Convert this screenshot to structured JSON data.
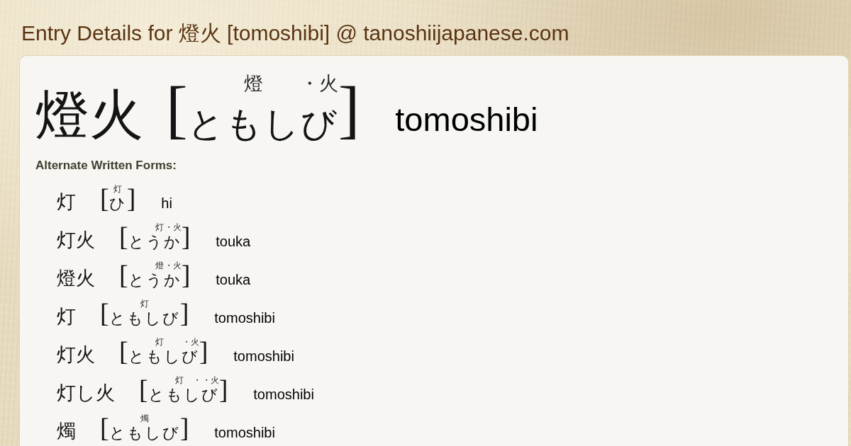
{
  "page": {
    "title": "Entry Details for 燈火 [tomoshibi] @ tanoshiijapanese.com"
  },
  "entry": {
    "word": "燈火",
    "reading": {
      "open": "[",
      "segments": [
        {
          "kana": "とも",
          "annotation": "燈"
        },
        {
          "kana": "しび",
          "annotation": "・火"
        }
      ],
      "close": "]"
    },
    "romaji": "tomoshibi"
  },
  "alternate_forms": {
    "heading": "Alternate Written Forms:",
    "items": [
      {
        "word": "灯",
        "reading": {
          "open": "[",
          "segments": [
            {
              "kana": "ひ",
              "annotation": "灯"
            }
          ],
          "close": "]"
        },
        "romaji": "hi"
      },
      {
        "word": "灯火",
        "reading": {
          "open": "[",
          "segments": [
            {
              "kana": "とう",
              "annotation": "灯"
            },
            {
              "kana": "か",
              "annotation": "・火"
            }
          ],
          "close": "]"
        },
        "romaji": "touka"
      },
      {
        "word": "燈火",
        "reading": {
          "open": "[",
          "segments": [
            {
              "kana": "とう",
              "annotation": "燈"
            },
            {
              "kana": "か",
              "annotation": "・火"
            }
          ],
          "close": "]"
        },
        "romaji": "touka"
      },
      {
        "word": "灯",
        "reading": {
          "open": "[",
          "segments": [
            {
              "kana": "ともしび",
              "annotation": "灯"
            }
          ],
          "close": "]"
        },
        "romaji": "tomoshibi"
      },
      {
        "word": "灯火",
        "reading": {
          "open": "[",
          "segments": [
            {
              "kana": "とも",
              "annotation": "灯"
            },
            {
              "kana": "しび",
              "annotation": "・火"
            }
          ],
          "close": "]"
        },
        "romaji": "tomoshibi"
      },
      {
        "word": "灯し火",
        "reading": {
          "open": "[",
          "segments": [
            {
              "kana": "とも",
              "annotation": "灯"
            },
            {
              "kana": "し",
              "annotation": "・"
            },
            {
              "kana": "び",
              "annotation": "・火"
            }
          ],
          "close": "]"
        },
        "romaji": "tomoshibi"
      },
      {
        "word": "燭",
        "reading": {
          "open": "[",
          "segments": [
            {
              "kana": "ともしび",
              "annotation": "燭"
            }
          ],
          "close": "]"
        },
        "romaji": "tomoshibi"
      }
    ]
  }
}
